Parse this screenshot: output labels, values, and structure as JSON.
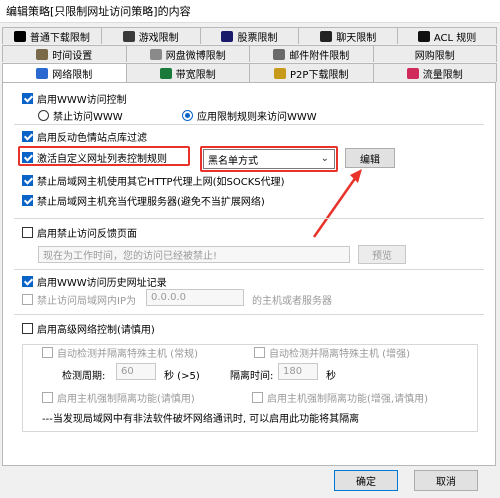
{
  "window": {
    "title": "编辑策略[只限制网址访问策略]的内容"
  },
  "tabs_row1": [
    {
      "label": "普通下载限制",
      "icon_color": "#000000"
    },
    {
      "label": "游戏限制",
      "icon_color": "#3a3a3a"
    },
    {
      "label": "股票限制",
      "icon_color": "#1a1a6a"
    },
    {
      "label": "聊天限制",
      "icon_color": "#222222"
    },
    {
      "label": "ACL 规则",
      "icon_color": "#111111"
    }
  ],
  "tabs_row2": [
    {
      "label": "时间设置",
      "icon_color": "#7a6a4a"
    },
    {
      "label": "网盘微博限制",
      "icon_color": "#8a8a8a"
    },
    {
      "label": "邮件附件限制",
      "icon_color": "#6a6a6a"
    },
    {
      "label": "网购限制",
      "icon_color": ""
    }
  ],
  "tabs_row3": [
    {
      "label": "网络限制",
      "icon_color": "#2a6ad0",
      "active": true
    },
    {
      "label": "带宽限制",
      "icon_color": "#1a7a3a"
    },
    {
      "label": "P2P下载限制",
      "icon_color": "#c89a1a"
    },
    {
      "label": "流量限制",
      "icon_color": "#d02a5a"
    }
  ],
  "www_control": {
    "enable_label": "启用WWW访问控制",
    "radio_forbid": "禁止访问WWW",
    "radio_rules": "应用限制规则来访问WWW"
  },
  "porn_filter": {
    "label": "启用反动色情站点库过滤"
  },
  "custom_list": {
    "label": "激活自定义网址列表控制规则",
    "mode_value": "黑名单方式",
    "edit_button": "编辑"
  },
  "http_proxy": {
    "label": "禁止局域网主机使用其它HTTP代理上网(如SOCKS代理)"
  },
  "act_proxy": {
    "label": "禁止局域网主机充当代理服务器(避免不当扩展网络)"
  },
  "feedback": {
    "label": "启用禁止访问反馈页面",
    "text_value": "现在为工作时间，您的访问已经被禁止!",
    "preview_button": "预览"
  },
  "history": {
    "label": "启用WWW访问历史网址记录",
    "forbid_ip_label": "禁止访问局域网内IP为",
    "ip_value": "0.0.0.0",
    "ip_suffix": "的主机或者服务器"
  },
  "advanced": {
    "label": "启用高级网络控制(请慎用)",
    "auto_normal": "自动检测并隔离特殊主机 (常规)",
    "auto_enhanced": "自动检测并隔离特殊主机 (增强)",
    "period_label": "检测周期:",
    "period_value": "60",
    "period_unit": "秒 (>5)",
    "isolate_label": "隔离时间:",
    "isolate_value": "180",
    "isolate_unit": "秒",
    "host_isolate": "启用主机强制隔离功能(请慎用)",
    "host_isolate_enh": "启用主机强制隔离功能(增强,请慎用)",
    "note": "---当发现局域网中有非法软件破坏网络通讯时, 可以启用此功能将其隔离"
  },
  "footer": {
    "ok_button": "确定",
    "cancel_button": "取消"
  },
  "colors": {
    "accent": "#0a64c8",
    "highlight_red": "#e8322a"
  }
}
